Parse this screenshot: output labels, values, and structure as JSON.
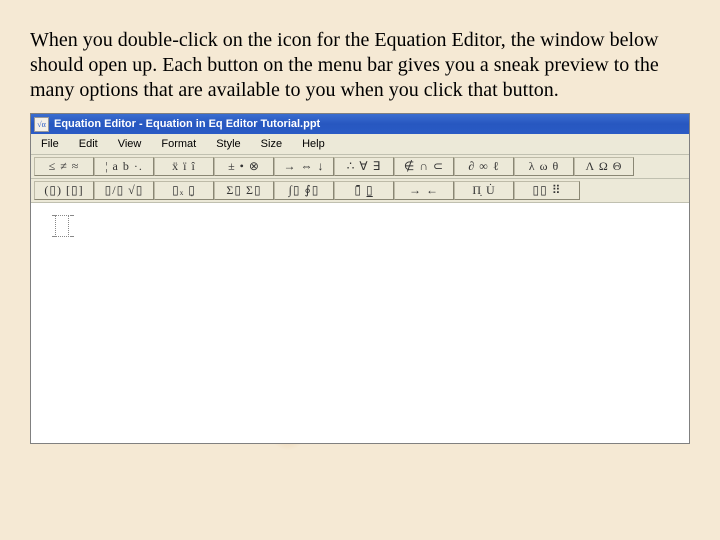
{
  "instruction_text": "When you double-click on the icon for the Equation Editor, the window below should open up. Each button on the menu bar gives you a sneak preview to the many options that are available to you when you click that button.",
  "window": {
    "title": "Equation Editor - Equation in Eq Editor Tutorial.ppt",
    "app_icon_glyph": "√α"
  },
  "menus": {
    "file": "File",
    "edit": "Edit",
    "view": "View",
    "format": "Format",
    "style": "Style",
    "size": "Size",
    "help": "Help"
  },
  "palette_row1": {
    "relational": "≤ ≠ ≈",
    "spaces": "¦ a b ·.",
    "embellish": "ẍ ï î",
    "operators": "± • ⊗",
    "arrows": "→ ⇔ ↓",
    "logical": "∴ ∀ ∃",
    "settheory": "∉ ∩ ⊂",
    "misc": "∂ ∞ ℓ",
    "greeklc": "λ ω θ",
    "greekuc": "Λ Ω Θ"
  },
  "palette_row2": {
    "fences": "(▯) [▯]",
    "fractions": "▯/▯ √▯",
    "subsup": "▯ₓ ▯̣",
    "sums": "Σ▯ Σ▯",
    "integrals": "∫▯ ∮▯",
    "bars": "▯̄ ▯̲",
    "arrows2": "→ ←",
    "products": "Π̣ U̇",
    "matrices": "▯▯ ⠿"
  }
}
